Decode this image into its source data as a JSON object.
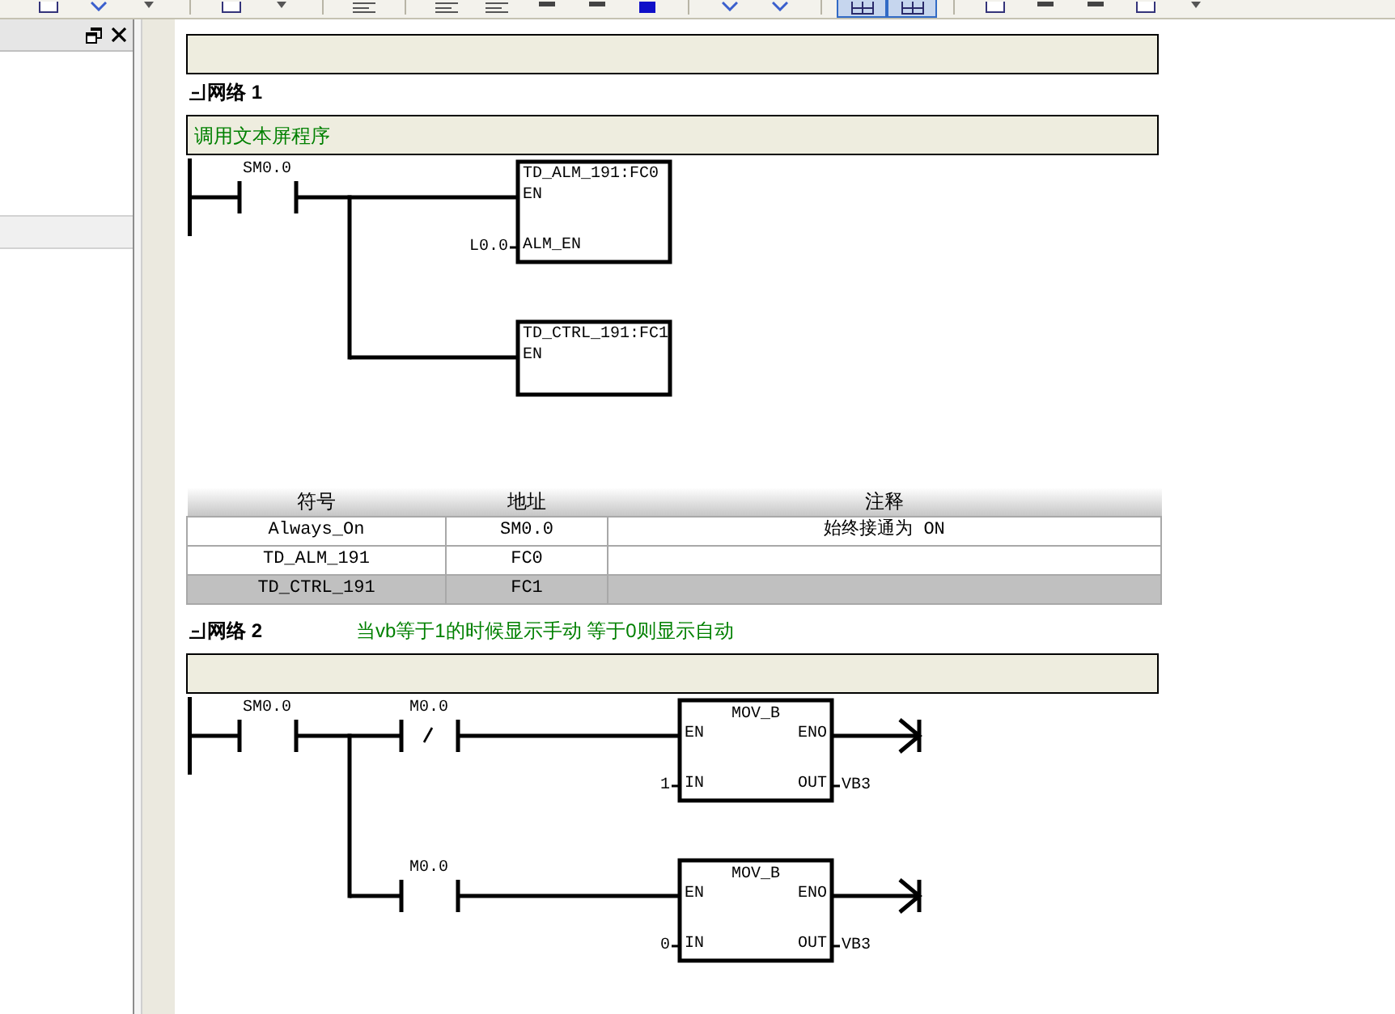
{
  "toolbar": {
    "buttons": [
      {
        "selected": false
      },
      {
        "selected": false
      },
      {
        "selected": false
      },
      {
        "selected": false
      },
      {
        "selected": false
      },
      {
        "selected": false
      },
      {
        "selected": false
      },
      {
        "selected": false
      },
      {
        "selected": false
      },
      {
        "selected": false
      },
      {
        "selected": false
      },
      {
        "selected": false
      },
      {
        "selected": false
      },
      {
        "selected": true
      },
      {
        "selected": true
      },
      {
        "selected": false
      },
      {
        "selected": false
      },
      {
        "selected": false
      },
      {
        "selected": false
      },
      {
        "selected": false
      }
    ]
  },
  "networks": [
    {
      "title": "网络 1",
      "comment": "调用文本屏程序",
      "rung": {
        "contact": {
          "operand": "SM0.0",
          "normally_closed": false
        },
        "branches": [
          {
            "block": {
              "kind": "call",
              "name": "TD_ALM_191:FC0",
              "inputs": [
                {
                  "pin": "EN"
                },
                {
                  "pin": "ALM_EN",
                  "operand": "L0.0"
                }
              ]
            }
          },
          {
            "block": {
              "kind": "call",
              "name": "TD_CTRL_191:FC1",
              "inputs": [
                {
                  "pin": "EN"
                }
              ]
            }
          }
        ]
      },
      "symbol_table": {
        "columns": [
          "符号",
          "地址",
          "注释"
        ],
        "rows": [
          {
            "symbol": "Always_On",
            "address": "SM0.0",
            "comment": "始终接通为 ON",
            "selected": false
          },
          {
            "symbol": "TD_ALM_191",
            "address": "FC0",
            "selected": false
          },
          {
            "symbol": "TD_CTRL_191",
            "address": "FC1",
            "selected": true
          }
        ]
      }
    },
    {
      "title": "网络 2",
      "title_comment": "当vb等于1的时候显示手动 等于0则显示自动",
      "rung": {
        "contact": {
          "operand": "SM0.0",
          "normally_closed": false
        },
        "branches": [
          {
            "contact": {
              "operand": "M0.0",
              "normally_closed": true
            },
            "block": {
              "kind": "box",
              "name": "MOV_B",
              "inputs": [
                {
                  "pin": "EN"
                },
                {
                  "pin": "IN",
                  "operand": "1"
                }
              ],
              "outputs": [
                {
                  "pin": "ENO"
                },
                {
                  "pin": "OUT",
                  "operand": "VB3"
                }
              ]
            }
          },
          {
            "contact": {
              "operand": "M0.0",
              "normally_closed": false
            },
            "block": {
              "kind": "box",
              "name": "MOV_B",
              "inputs": [
                {
                  "pin": "EN"
                },
                {
                  "pin": "IN",
                  "operand": "0"
                }
              ],
              "outputs": [
                {
                  "pin": "ENO"
                },
                {
                  "pin": "OUT",
                  "operand": "VB3"
                }
              ]
            }
          }
        ]
      }
    }
  ]
}
